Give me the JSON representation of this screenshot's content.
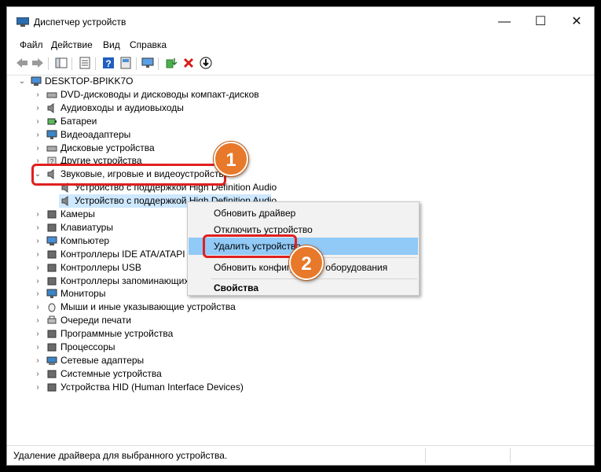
{
  "window": {
    "title": "Диспетчер устройств",
    "controls": {
      "minimize": "—",
      "maximize": "☐",
      "close": "✕"
    }
  },
  "menu": [
    "Файл",
    "Действие",
    "Вид",
    "Справка"
  ],
  "toolbar_icons": [
    "back-icon",
    "forward-icon",
    "show-hide-tree-icon",
    "properties-icon",
    "help-icon",
    "monitor-icon",
    "update-driver-icon",
    "remove-device-icon",
    "download-icon"
  ],
  "tree": {
    "root": "DESKTOP-BPIKK7O",
    "categories": [
      "DVD-дисководы и дисководы компакт-дисков",
      "Аудиовходы и аудиовыходы",
      "Батареи",
      "Видеоадаптеры",
      "Дисковые устройства",
      "Другие устройства",
      "Звуковые, игровые и видеоустройства",
      "Камеры",
      "Клавиатуры",
      "Компьютер",
      "Контроллеры IDE ATA/ATAPI",
      "Контроллеры USB",
      "Контроллеры запоминающих устройств",
      "Мониторы",
      "Мыши и иные указывающие устройства",
      "Очереди печати",
      "Программные устройства",
      "Процессоры",
      "Сетевые адаптеры",
      "Системные устройства",
      "Устройства HID (Human Interface Devices)"
    ],
    "expanded_children": [
      "Устройство с поддержкой High Definition Audio",
      "Устройство с поддержкой High Definition Audio"
    ]
  },
  "context_menu": {
    "items": [
      "Обновить драйвер",
      "Отключить устройство",
      "Удалить устройство",
      "Обновить конфигурацию оборудования",
      "Свойства"
    ]
  },
  "status": {
    "text": "Удаление драйвера для выбранного устройства."
  },
  "annotations": {
    "step1": "1",
    "step2": "2"
  },
  "colors": {
    "selection": "#cde8ff",
    "menu_highlight": "#91c9f7",
    "annotation_red": "#e02020",
    "badge_orange": "#e8782a"
  }
}
